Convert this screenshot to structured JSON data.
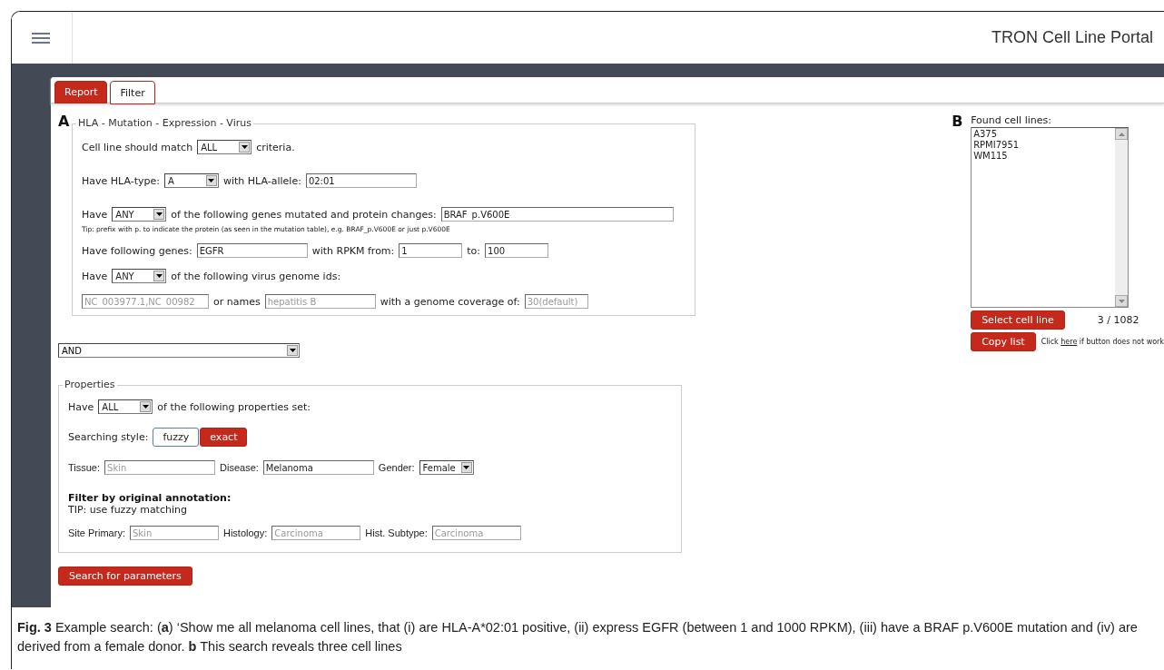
{
  "header": {
    "title": "TRON Cell Line Portal"
  },
  "tabs": [
    {
      "label": "Report",
      "selected": false
    },
    {
      "label": "Filter",
      "selected": true
    }
  ],
  "panel_a": {
    "marker": "A",
    "legend": "HLA - Mutation - Expression - Virus",
    "lines": [
      {
        "parts": [
          {
            "kind": "text",
            "text": "Cell line should match"
          },
          {
            "kind": "select",
            "value": "ALL"
          },
          {
            "kind": "text",
            "text": "criteria."
          }
        ]
      },
      {
        "parts": [
          {
            "kind": "text",
            "text": "Have HLA-type:"
          },
          {
            "kind": "select",
            "value": "A"
          },
          {
            "kind": "text",
            "text": "with HLA-allele:"
          },
          {
            "kind": "field",
            "value": "02:01"
          }
        ]
      },
      {
        "parts": [
          {
            "kind": "text",
            "text": "Have"
          },
          {
            "kind": "select",
            "value": "ANY"
          },
          {
            "kind": "text",
            "text": "of the following genes mutated and protein changes:"
          },
          {
            "kind": "largefield",
            "value": "BRAF_p.V600E"
          }
        ]
      },
      {
        "parts": [
          {
            "kind": "tip",
            "text": "Tip: prefix with p. to indicate the protein (as seen in the mutation table), e.g. BRAF_p.V600E or just p.V600E"
          }
        ]
      },
      {
        "parts": [
          {
            "kind": "text",
            "text": "Have following genes:"
          },
          {
            "kind": "field",
            "value": "EGFR"
          },
          {
            "kind": "text",
            "text": "with RPKM from:"
          },
          {
            "kind": "smallfield",
            "value": "1"
          },
          {
            "kind": "text",
            "text": "to:"
          },
          {
            "kind": "smallfield",
            "value": "100"
          }
        ]
      },
      {
        "parts": [
          {
            "kind": "text",
            "text": "Have"
          },
          {
            "kind": "select",
            "value": "ANY"
          },
          {
            "kind": "text",
            "text": "of the following virus genome ids:"
          }
        ]
      },
      {
        "parts": [
          {
            "kind": "idsfield",
            "placeholder": "NC_003977.1,NC_00982"
          },
          {
            "kind": "text",
            "text": "or names"
          },
          {
            "kind": "field",
            "placeholder": "hepatitis B"
          },
          {
            "kind": "text",
            "text": "with a genome coverage of:"
          },
          {
            "kind": "smallfield",
            "placeholder": "30(default)"
          }
        ]
      }
    ]
  },
  "combine": {
    "value": "AND"
  },
  "properties": {
    "legend": "Properties",
    "lines": [
      {
        "parts": [
          {
            "kind": "text",
            "text": "Have"
          },
          {
            "kind": "select",
            "value": "ALL"
          },
          {
            "kind": "text",
            "text": "of the following properties set:"
          }
        ]
      },
      {
        "parts": [
          {
            "kind": "text",
            "text": "Searching style:"
          },
          {
            "kind": "toggles",
            "options": [
              {
                "label": "fuzzy",
                "selected": true
              },
              {
                "label": "exact",
                "selected": false
              }
            ]
          }
        ]
      },
      {
        "parts": [
          {
            "kind": "label",
            "text": "Tissue:"
          },
          {
            "kind": "field",
            "placeholder": "Skin"
          },
          {
            "kind": "label",
            "text": "Disease:"
          },
          {
            "kind": "field",
            "value": "Melanoma"
          },
          {
            "kind": "label",
            "text": "Gender:"
          },
          {
            "kind": "select",
            "value": "Female"
          }
        ]
      },
      {
        "parts": [
          {
            "kind": "heading",
            "text": "Filter by original annotation:"
          }
        ]
      },
      {
        "parts": [
          {
            "kind": "note",
            "text": "TIP: use fuzzy matching"
          }
        ]
      },
      {
        "parts": [
          {
            "kind": "label",
            "text": "Site Primary:"
          },
          {
            "kind": "narrowfield",
            "placeholder": "Skin"
          },
          {
            "kind": "label",
            "text": "Histology:"
          },
          {
            "kind": "narrowfield",
            "placeholder": "Carcinoma"
          },
          {
            "kind": "label",
            "text": "Hist. Subtype:"
          },
          {
            "kind": "narrowfield",
            "placeholder": "Carcinoma"
          }
        ]
      }
    ]
  },
  "search_button": "Search for parameters",
  "panel_b": {
    "marker": "B",
    "label": "Found cell lines:",
    "items": [
      "A375",
      "RPMI7951",
      "WM115"
    ],
    "select_button": "Select cell line",
    "count": "3 / 1082",
    "copy_button": "Copy list",
    "hint_before": "Click",
    "hint_link": "here",
    "hint_after": "if button does not work"
  },
  "caption": "**Fig. 3** Example search: (**a**) ‘Show me all melanoma cell lines, that (i) are HLA-A*02:01 positive, (ii) express EGFR (between 1 and 1000 RPKM), (iii) have a BRAF p.V600E mutation and (iv) are derived from a female donor. **b** This search reveals three cell lines"
}
